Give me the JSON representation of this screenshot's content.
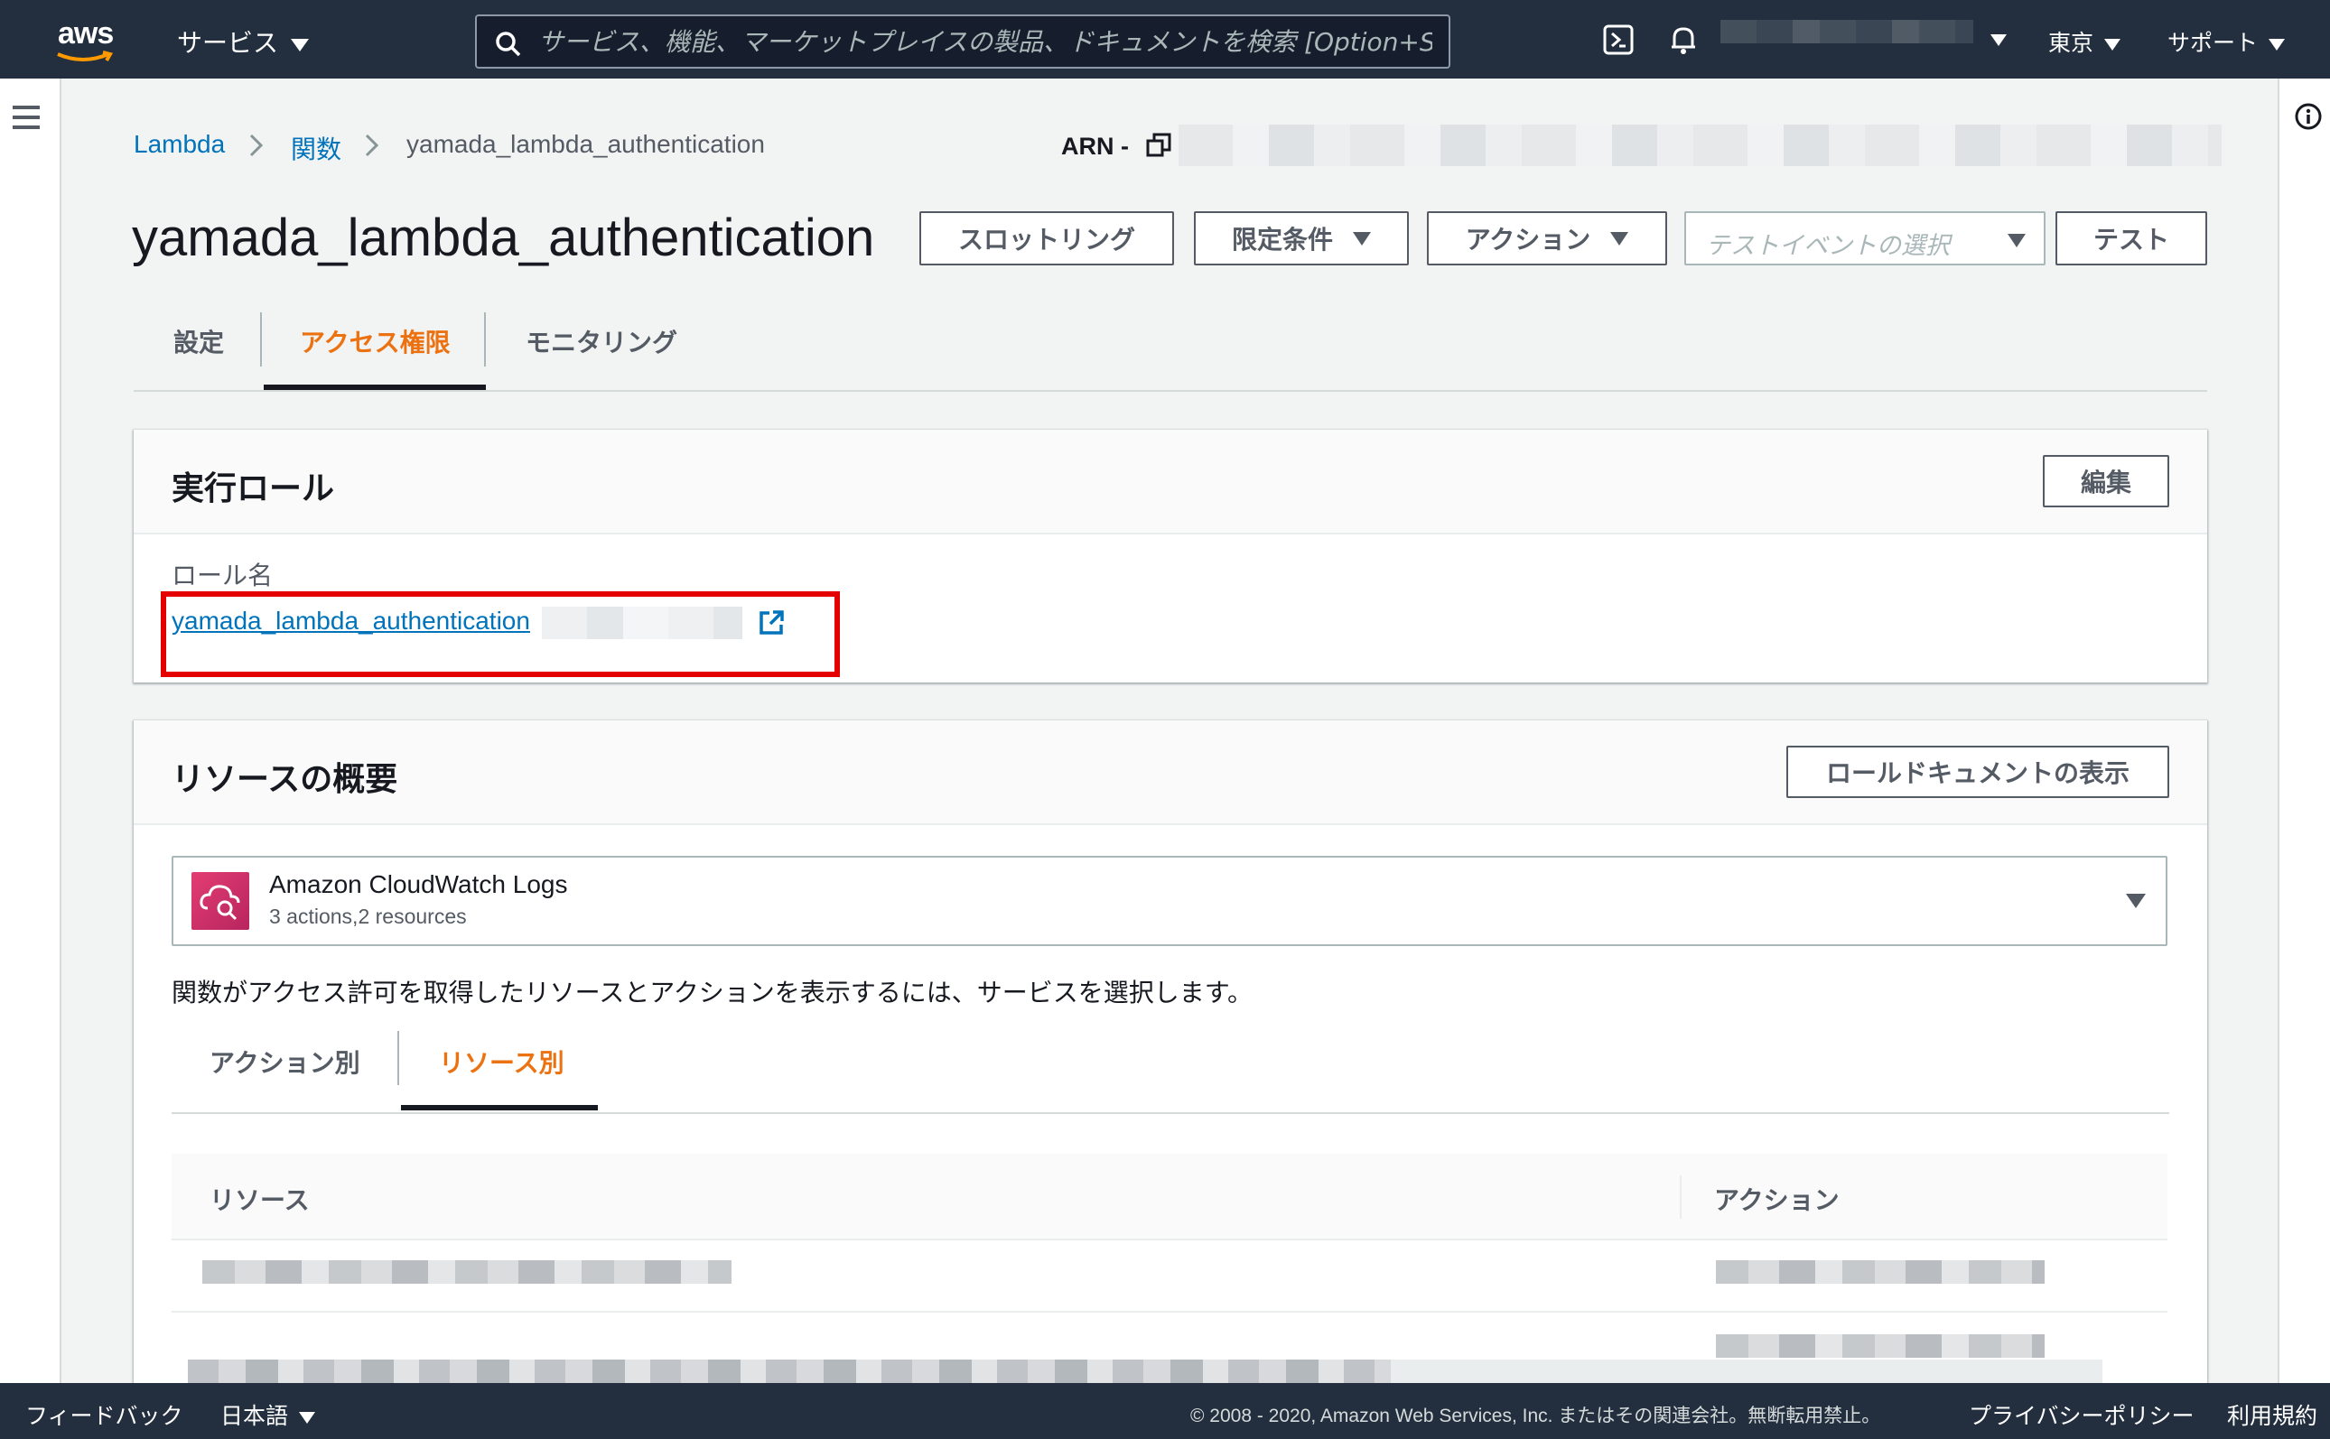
{
  "topnav": {
    "logo_text": "aws",
    "services_label": "サービス",
    "search_placeholder": "サービス、機能、マーケットプレイスの製品、ドキュメントを検索 [Option+S]",
    "region_label": "東京",
    "support_label": "サポート"
  },
  "breadcrumb": {
    "items": [
      "Lambda",
      "関数",
      "yamada_lambda_authentication"
    ]
  },
  "arn_label": "ARN -",
  "function": {
    "title": "yamada_lambda_authentication"
  },
  "toolbar": {
    "throttle_label": "スロットリング",
    "qualifier_label": "限定条件",
    "actions_label": "アクション",
    "test_event_placeholder": "テストイベントの選択",
    "test_label": "テスト"
  },
  "tabs": [
    "設定",
    "アクセス権限",
    "モニタリング"
  ],
  "execution_role": {
    "title": "実行ロール",
    "edit_label": "編集",
    "role_name_label": "ロール名",
    "role_name_link": "yamada_lambda_authentication"
  },
  "resource_summary": {
    "title": "リソースの概要",
    "view_document_label": "ロールドキュメントの表示",
    "service": {
      "name": "Amazon CloudWatch Logs",
      "sub": "3 actions,2 resources",
      "icon": "cloudwatch-logs-icon"
    },
    "hint": "関数がアクセス許可を取得したリソースとアクションを表示するには、サービスを選択します。",
    "subtabs": [
      "アクション別",
      "リソース別"
    ],
    "table_headers": [
      "リソース",
      "アクション"
    ]
  },
  "footer": {
    "feedback_label": "フィードバック",
    "language_label": "日本語",
    "copyright": "© 2008 - 2020, Amazon Web Services, Inc. またはその関連会社。無断転用禁止。",
    "privacy_label": "プライバシーポリシー",
    "terms_label": "利用規約"
  },
  "colors": {
    "nav_bg": "#232f3e",
    "accent_orange": "#ec7211",
    "link_blue": "#0073bb",
    "highlight_red": "#e50000"
  }
}
